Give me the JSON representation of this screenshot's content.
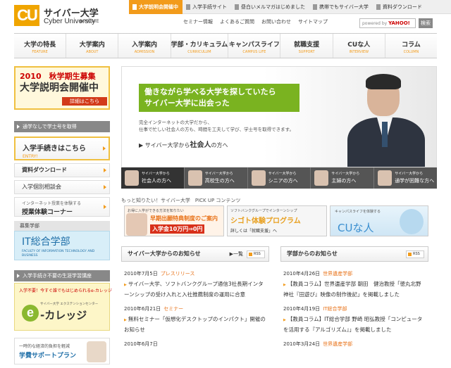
{
  "header": {
    "logo_mark": "CU",
    "logo_jp": "サイバー大学",
    "logo_en": "Cyber University",
    "home_label": "▶HOME",
    "top_links": [
      "大学説明会開催中",
      "入学手続サイト",
      "昼白いメルマガはじめました",
      "携帯でもサイバー大学",
      "資料ダウンロード"
    ],
    "sub_links": [
      "セミナー情報",
      "よくあるご質問",
      "お問い合わせ",
      "サイトマップ"
    ],
    "search_placeholder": "powered by",
    "search_brand": "YAHOO!",
    "search_button": "検索"
  },
  "nav": [
    {
      "label": "大学の特長",
      "sub": "FEATURE"
    },
    {
      "label": "大学案内",
      "sub": "ABOUT"
    },
    {
      "label": "入学案内",
      "sub": "ADMISSION"
    },
    {
      "label": "学部・カリキュラム",
      "sub": "CURRICULUM"
    },
    {
      "label": "キャンパスライフ",
      "sub": "CAMPUS LIFE"
    },
    {
      "label": "就職支援",
      "sub": "SUPPORT"
    },
    {
      "label": "CUな人",
      "sub": "INTERVIEW"
    },
    {
      "label": "コラム",
      "sub": "COLUMN"
    }
  ],
  "left": {
    "banner_line1": "2010　秋学期生募集",
    "banner_line2": "大学説明会開催中",
    "banner_button": "詳細はこちら",
    "section1_heading": "通学なしで学士号を取得",
    "entry_label": "入学手続きはこちら",
    "entry_sub": "ENTRY!",
    "doc_label": "資料ダウンロード",
    "individual_label": "入学個別相談会",
    "trial_sub": "インターネット授業を体験する",
    "trial_label": "授業体験コーナー",
    "faculty_heading": "募集学部",
    "faculty_name": "IT総合学部",
    "faculty_en": "FACULTY OF INFORMATION TECHNOLOGY AND BUSINESS",
    "section2_heading": "入学手続き不要の生涯学習講座",
    "ext_line1": "入学不要！今すぐ誰でもはじめられるe-カレッジ",
    "ext_center": "サイバー大学 エクステンションセンター",
    "ext_logo": "e",
    "ext_name": "-カレッジ",
    "support_line1": "一時的な経済的負担を軽減",
    "support_label": "学費サポートプラン"
  },
  "hero": {
    "catch_line1": "働きながら学べる大学を探していたら",
    "catch_line2": "サイバー大学に出会った",
    "desc_line1": "完全インターネットの大学だから、",
    "desc_line2": "仕事で忙しい社会人の方も、時間を工夫して学び、学士号を取得できます。",
    "more_prefix": "サイバー大学から",
    "more_target": "社会人",
    "more_suffix": "の方へ"
  },
  "personas": [
    {
      "sub": "サイバー大学から",
      "label": "社会人の方へ"
    },
    {
      "sub": "サイバー大学から",
      "label": "高校生の方へ"
    },
    {
      "sub": "サイバー大学から",
      "label": "シニアの方へ"
    },
    {
      "sub": "サイバー大学から",
      "label": "主婦の方へ"
    },
    {
      "sub": "サイバー大学から",
      "label": "通学が困難な方へ"
    }
  ],
  "pickup": {
    "heading": "もっと知りたい！サイバー大学　PICK UP コンテンツ",
    "p1_line1": "お得に入学ができる方法を知りたい",
    "p1_line2": "早期出願特典制度のご案内",
    "p1_line3": "入学金10万円⇒0円",
    "p2_line1": "ソフトバンクグループでインターンシップ",
    "p2_line2": "シゴト体験プログラム",
    "p2_line3": "詳しくは「就職支援」へ",
    "p3_line1": "キャンパスライフを体験する",
    "p3_line2": "CUな人"
  },
  "news_left": {
    "heading": "サイバー大学からのお知らせ",
    "more_label": "一覧",
    "rss_label": "RSS",
    "items": [
      {
        "date": "2010年7月5日",
        "category": "プレスリリース",
        "text": "サイバー大学、ソフトバンクグループ通信3社長期インターンシップの受け入れと入社推薦制度の運用に合意"
      },
      {
        "date": "2010年6月21日",
        "category": "セミナー",
        "text": "無料セミナー「仮想化デスクトップのインパクト」開催のお知らせ"
      },
      {
        "date": "2010年6月7日",
        "category": "",
        "text": ""
      }
    ]
  },
  "news_right": {
    "heading": "学部からのお知らせ",
    "rss_label": "RSS",
    "items": [
      {
        "date": "2010年4月26日",
        "category": "世界遺産学部",
        "text": "【教員コラム】世界遺産学部 朝田　健治教授「徳丸北野神社『田遊び』映像の制作後記」を掲載しました"
      },
      {
        "date": "2010年4月19日",
        "category": "IT総合学部",
        "text": "【教員コラム】IT総合学部 野崎 昭弘教授「コンピュータを活用する『アルゴリズム』」を掲載しました"
      },
      {
        "date": "2010年3月24日",
        "category": "世界遺産学部",
        "text": ""
      }
    ]
  }
}
